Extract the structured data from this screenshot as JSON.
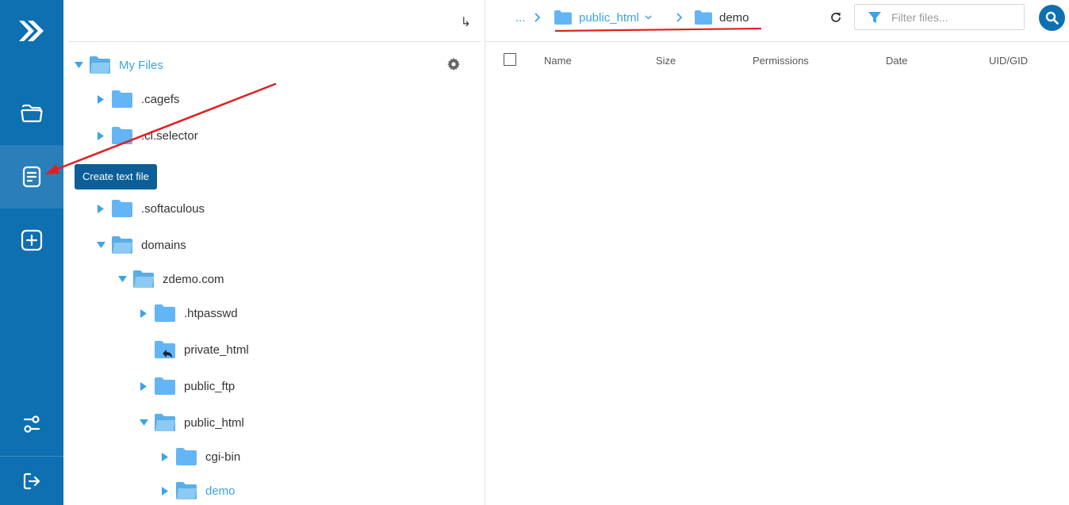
{
  "tooltip": {
    "text": "Create text file"
  },
  "rail": {
    "items": [
      {
        "icon": "folder-open-icon"
      },
      {
        "icon": "text-file-icon"
      },
      {
        "icon": "add-square-icon"
      },
      {
        "icon": "settings-sliders-icon"
      },
      {
        "icon": "logout-icon"
      }
    ]
  },
  "tree": {
    "collapse_icon": "↳",
    "root": {
      "label": "My Files"
    },
    "items": [
      {
        "label": ".cagefs"
      },
      {
        "label": ".cl.selector"
      },
      {
        "label": ".softaculous"
      },
      {
        "label": "domains"
      },
      {
        "label": "zdemo.com"
      },
      {
        "label": ".htpasswd"
      },
      {
        "label": "private_html"
      },
      {
        "label": "public_ftp"
      },
      {
        "label": "public_html"
      },
      {
        "label": "cgi-bin"
      },
      {
        "label": "demo"
      }
    ]
  },
  "breadcrumb": {
    "ellipsis": "...",
    "parent": "public_html",
    "current": "demo"
  },
  "filter": {
    "placeholder": "Filter files..."
  },
  "table": {
    "columns": [
      "Name",
      "Size",
      "Permissions",
      "Date",
      "UID/GID"
    ]
  },
  "colors": {
    "rail": "#0e6fb1",
    "accent": "#3ba3e6",
    "folder": "#64b5f6",
    "annotation": "#e02020"
  }
}
